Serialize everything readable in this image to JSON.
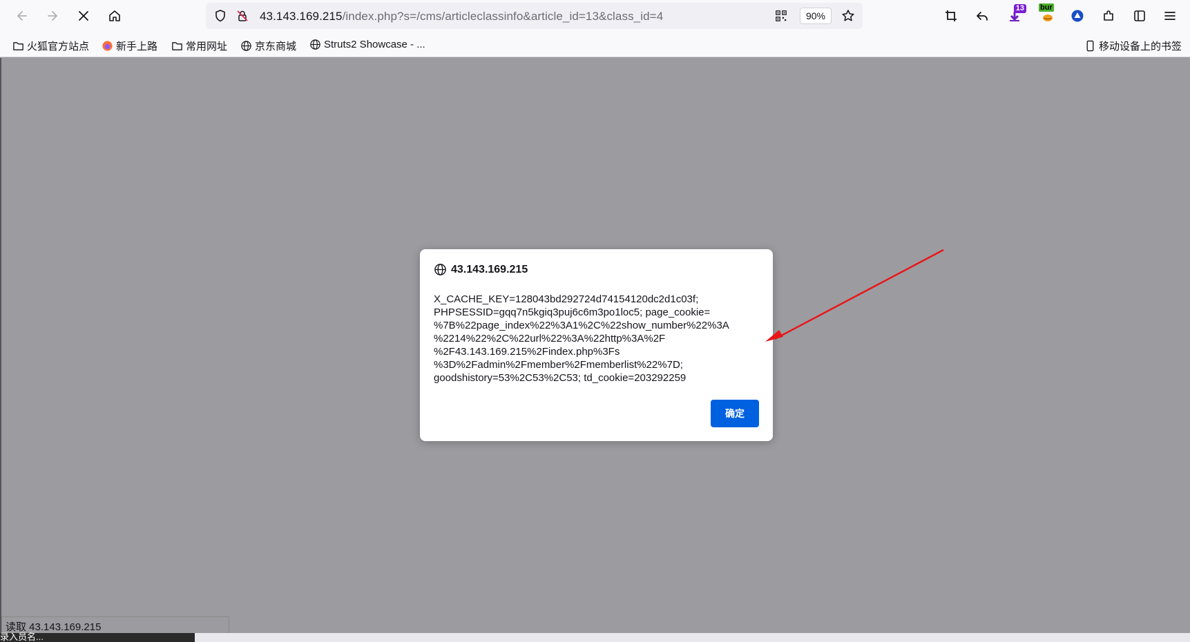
{
  "toolbar": {
    "back_icon": "back-arrow-icon",
    "forward_icon": "forward-arrow-icon",
    "stop_icon": "stop-icon",
    "home_icon": "home-icon",
    "url_host": "43.143.169.215",
    "url_rest": "/index.php?s=/cms/articleclassinfo&article_id=13&class_id=4",
    "zoom": "90%",
    "ext_badge_count": "13",
    "ext_badge_bur": "bur"
  },
  "bookmarks": [
    {
      "label": "火狐官方站点",
      "icon": "folder-icon"
    },
    {
      "label": "新手上路",
      "icon": "firefox-icon"
    },
    {
      "label": "常用网址",
      "icon": "folder-icon"
    },
    {
      "label": "京东商城",
      "icon": "globe-icon"
    },
    {
      "label": "Struts2 Showcase - ...",
      "icon": "globe-icon"
    }
  ],
  "mobile_bookmarks": "移动设备上的书签",
  "dialog": {
    "title": "43.143.169.215",
    "message_lines": [
      "X_CACHE_KEY=128043bd292724d74154120dc2d1c03f;",
      "PHPSESSID=gqq7n5kgiq3puj6c6m3po1loc5; page_cookie=",
      "%7B%22page_index%22%3A1%2C%22show_number%22%3A",
      "%2214%22%2C%22url%22%3A%22http%3A%2F",
      "%2F43.143.169.215%2Findex.php%3Fs",
      "%3D%2Fadmin%2Fmember%2Fmemberlist%22%7D;",
      "goodshistory=53%2C53%2C53; td_cookie=203292259"
    ],
    "ok_label": "确定"
  },
  "status_text": "读取 43.143.169.215",
  "bottom_text": "录入员名..."
}
